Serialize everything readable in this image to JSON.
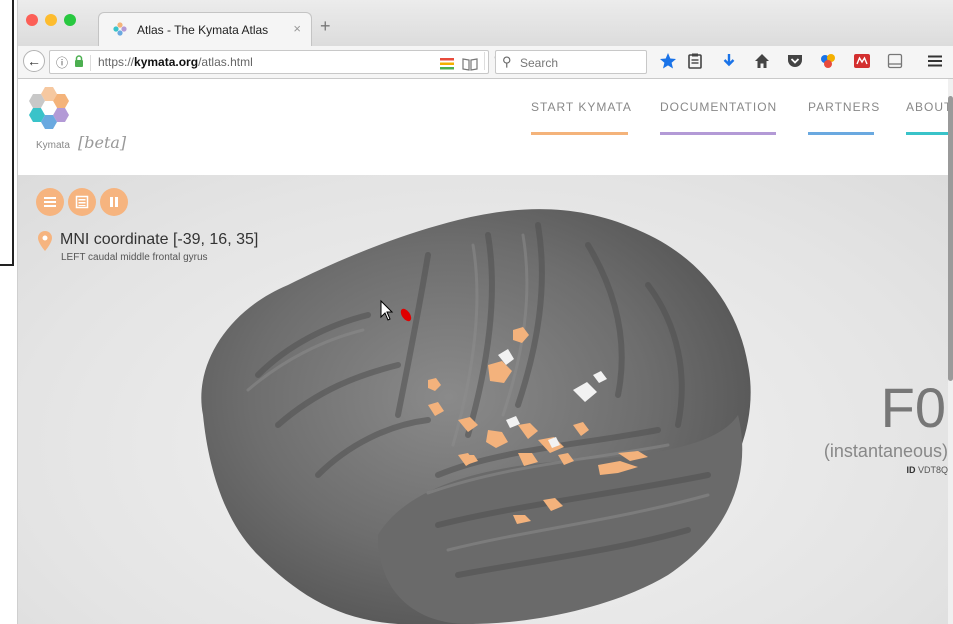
{
  "browser": {
    "tab_title": "Atlas - The Kymata Atlas",
    "tab_close": "×",
    "new_tab": "+",
    "url_prefix": "https://",
    "url_domain": "kymata.org",
    "url_path": "/atlas.html",
    "search_placeholder": "Search"
  },
  "site": {
    "logo_text": "Kymata",
    "logo_beta": "[beta]",
    "nav": [
      {
        "label": "START KYMATA",
        "color": "#f4b37a"
      },
      {
        "label": "DOCUMENTATION",
        "color": "#b39ad6"
      },
      {
        "label": "PARTNERS",
        "color": "#6aa9e0"
      },
      {
        "label": "ABOUT",
        "color": "#39c3c9"
      }
    ]
  },
  "viewer": {
    "coordinate": "MNI coordinate [-39, 16, 35]",
    "region": "LEFT caudal middle frontal gyrus",
    "function_name": "F0",
    "function_sub": "(instantaneous)",
    "id_label": "ID",
    "id_value": "VDT8Q",
    "accent_color": "#f6b47f"
  }
}
